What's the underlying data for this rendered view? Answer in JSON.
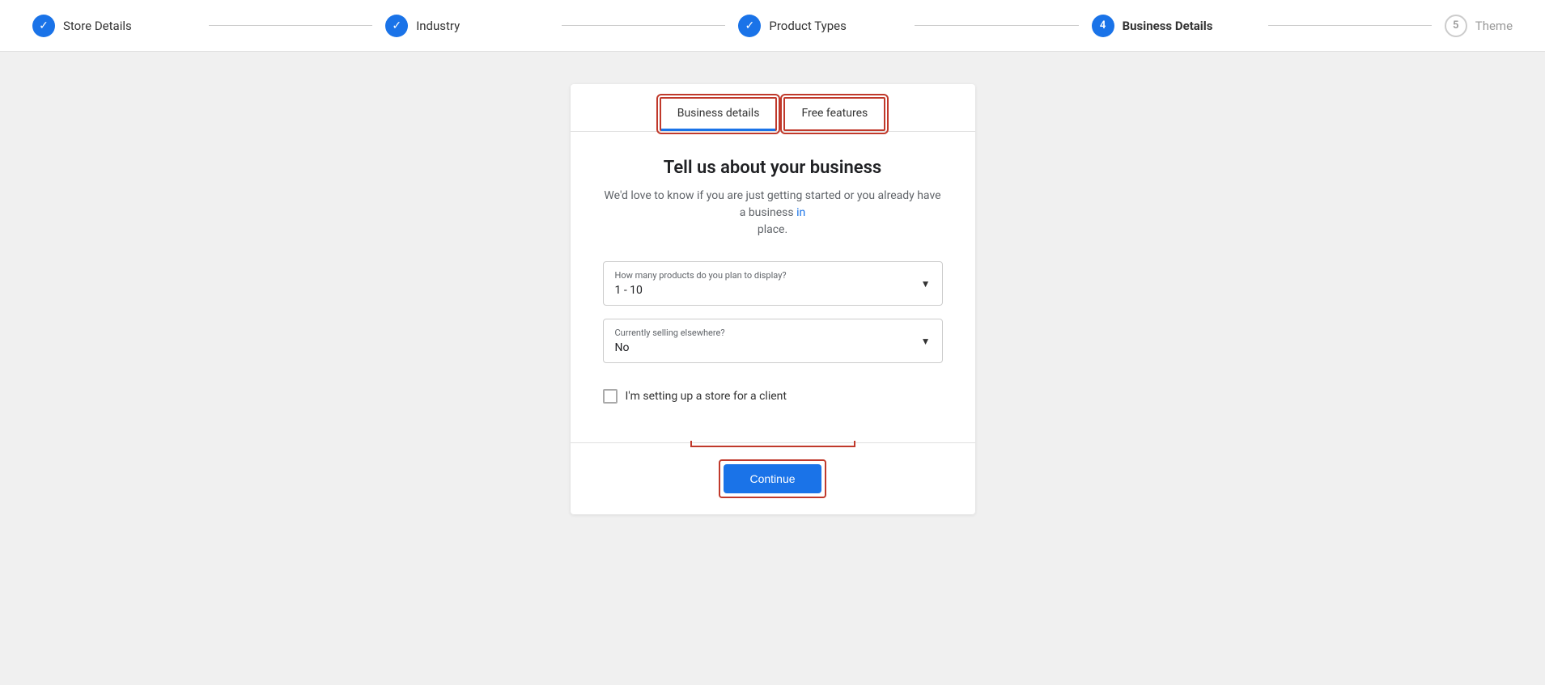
{
  "stepper": {
    "steps": [
      {
        "id": "store-details",
        "label": "Store Details",
        "type": "check",
        "active": false
      },
      {
        "id": "industry",
        "label": "Industry",
        "type": "check",
        "active": false
      },
      {
        "id": "product-types",
        "label": "Product Types",
        "type": "check",
        "active": false
      },
      {
        "id": "business-details",
        "label": "Business Details",
        "type": "number",
        "number": "4",
        "active": true
      },
      {
        "id": "theme",
        "label": "Theme",
        "type": "number-plain",
        "number": "5",
        "active": false
      }
    ]
  },
  "tabs": [
    {
      "id": "business-details-tab",
      "label": "Business details",
      "active": true
    },
    {
      "id": "free-features-tab",
      "label": "Free features",
      "active": false
    }
  ],
  "form": {
    "title": "Tell us about your business",
    "subtitle_part1": "We'd love to know if you are just getting started or you already have a business in",
    "subtitle_part2": "place.",
    "subtitle_link": "in",
    "products_dropdown": {
      "label": "How many products do you plan to display?",
      "value": "1 - 10"
    },
    "selling_dropdown": {
      "label": "Currently selling elsewhere?",
      "value": "No"
    },
    "checkbox": {
      "label": "I'm setting up a store for a client",
      "checked": false
    },
    "continue_button": "Continue"
  }
}
